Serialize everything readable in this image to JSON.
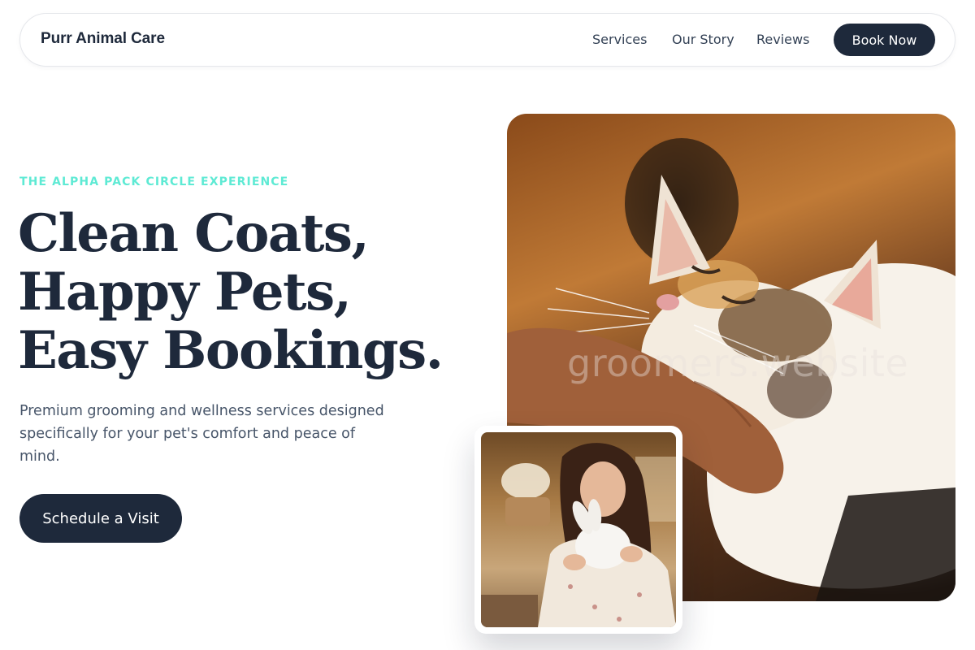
{
  "nav": {
    "brand": "Purr Animal Care",
    "links": [
      {
        "label": "Services"
      },
      {
        "label": "Our Story"
      },
      {
        "label": "Reviews"
      }
    ],
    "cta_label": "Book Now"
  },
  "hero": {
    "eyebrow": "THE ALPHA PACK CIRCLE EXPERIENCE",
    "headline": [
      "Clean Coats,",
      "Happy Pets,",
      "Easy Bookings."
    ],
    "subtext": "Premium grooming and wellness services designed specifically for your pet's comfort and peace of mind.",
    "cta_label": "Schedule a Visit"
  },
  "images": {
    "main_watermark": "groomers.website"
  },
  "colors": {
    "primary": "#1e293b",
    "accent": "#5eead4",
    "muted_text": "#475569"
  }
}
